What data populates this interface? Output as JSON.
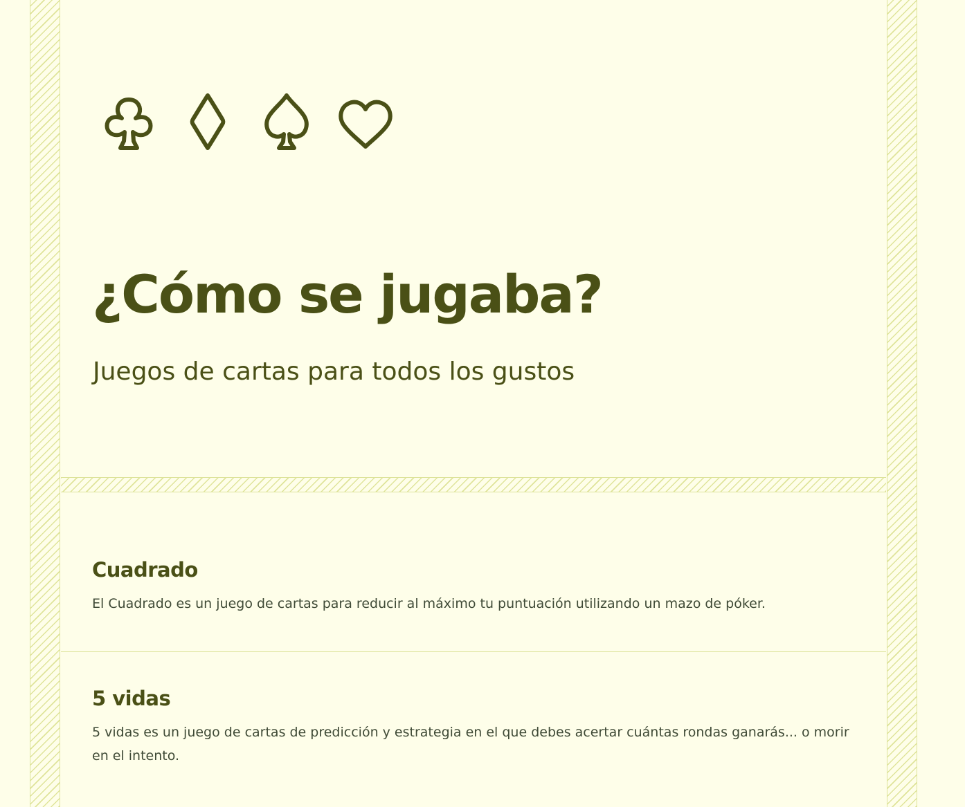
{
  "hero": {
    "suits": [
      "club-icon",
      "diamond-icon",
      "spade-icon",
      "heart-icon"
    ],
    "title": "¿Cómo se jugaba?",
    "subtitle": "Juegos de cartas para todos los gustos"
  },
  "games": [
    {
      "title": "Cuadrado",
      "description": "El Cuadrado es un juego de cartas para reducir al máximo tu puntuación utilizando un mazo de póker."
    },
    {
      "title": "5 vidas",
      "description": "5 vidas es un juego de cartas de predicción y estrategia en el que debes acertar cuántas rondas ganarás... o morir en el intento."
    }
  ],
  "colors": {
    "background": "#fefee9",
    "primary": "#4a5016",
    "body_text": "#3f4a36",
    "hatch": "#dfe49a",
    "border": "#dde39a"
  }
}
